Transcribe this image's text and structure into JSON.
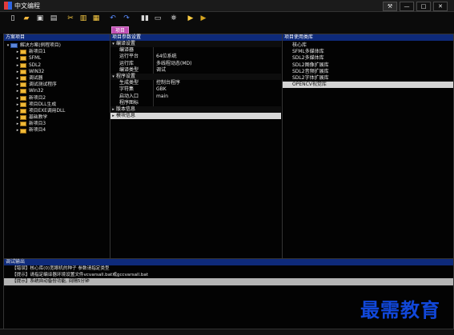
{
  "window": {
    "title": "中文编程",
    "controls": {
      "tool": "⚒",
      "minimize": "—",
      "maximize": "□",
      "close": "✕"
    }
  },
  "toolbar": {
    "tabs": {
      "project": "项目"
    },
    "icons": [
      {
        "name": "new-file-icon",
        "glyph": "▯",
        "color": "#f3f3f3"
      },
      {
        "name": "open-folder-icon",
        "glyph": "▰",
        "color": "#f2b73d"
      },
      {
        "name": "save-icon",
        "glyph": "▣",
        "color": "#d9d9d9"
      },
      {
        "name": "save-all-icon",
        "glyph": "▤",
        "color": "#d9d9d9"
      },
      {
        "name": "cut-icon",
        "glyph": "✂",
        "color": "#ffcf44"
      },
      {
        "name": "copy-icon",
        "glyph": "▥",
        "color": "#ffcf44"
      },
      {
        "name": "paste-icon",
        "glyph": "▦",
        "color": "#ffcf44"
      },
      {
        "name": "undo-icon",
        "glyph": "↶",
        "color": "#5a8cff"
      },
      {
        "name": "redo-icon",
        "glyph": "↷",
        "color": "#5a8cff"
      },
      {
        "name": "split-icon",
        "glyph": "▮▮",
        "color": "#d9d9d9"
      },
      {
        "name": "window-icon",
        "glyph": "▭",
        "color": "#d9d9d9"
      },
      {
        "name": "find-icon",
        "glyph": "⛯",
        "color": "#d9d9d9"
      },
      {
        "name": "run-icon",
        "glyph": "▶",
        "color": "#ffcf44"
      },
      {
        "name": "step-icon",
        "glyph": "▶",
        "color": "#d6a41f"
      }
    ]
  },
  "panels": {
    "left": {
      "title": "方案项目",
      "root": "解决方案(例程项目)",
      "items": [
        "新项目1",
        "SFML",
        "SDL2",
        "WIN32",
        "调试器",
        "调试测试程序",
        "Win32",
        "新项目2",
        "项目DLL生成",
        "项目EXE调用DLL",
        "基础教学",
        "新项目3",
        "新项目4"
      ]
    },
    "middle": {
      "title": "项目参数设置",
      "rows": [
        {
          "type": "section",
          "label": "编译设置",
          "expander": "▾",
          "value": ""
        },
        {
          "type": "prop",
          "label": "编译器",
          "value": ""
        },
        {
          "type": "prop",
          "label": "运行平台",
          "value": "64位系统"
        },
        {
          "type": "prop",
          "label": "运行库",
          "value": "多线程动态(MD)"
        },
        {
          "type": "prop",
          "label": "编译类型",
          "value": "调试"
        },
        {
          "type": "section",
          "label": "程序设置",
          "expander": "▾",
          "value": ""
        },
        {
          "type": "prop",
          "label": "生成类型",
          "value": "控制台程序"
        },
        {
          "type": "prop",
          "label": "字符集",
          "value": "GBK"
        },
        {
          "type": "prop",
          "label": "启动入口",
          "value": "main"
        },
        {
          "type": "prop",
          "label": "程序图标",
          "value": ""
        },
        {
          "type": "section",
          "label": "版本信息",
          "expander": "▸",
          "value": ""
        },
        {
          "type": "section",
          "label": "模块信息",
          "expander": "▸",
          "value": "",
          "selected": true
        }
      ]
    },
    "right": {
      "title": "项目使用类库",
      "items": [
        {
          "label": "核心库"
        },
        {
          "label": "SFML多媒体库"
        },
        {
          "label": "SDL2多媒体库"
        },
        {
          "label": "SDL2图像扩展库"
        },
        {
          "label": "SDL2音频扩展库"
        },
        {
          "label": "SDL2字体扩展库"
        },
        {
          "label": "OPENCV视觉库",
          "selected": true
        }
      ]
    }
  },
  "output": {
    "title": "调试输出",
    "lines": [
      {
        "text": "【错误】核心库(0)宽眼机的种子 参数请指定类型",
        "highlight": false
      },
      {
        "text": "【提示】请指定编译器环境设置文件vcvarsall.bat或gccvarsall.bat",
        "highlight": false
      },
      {
        "text": "【提示】系统自动备份功能, 间隔5分钟",
        "highlight": true
      }
    ]
  },
  "watermark": "最需教育"
}
